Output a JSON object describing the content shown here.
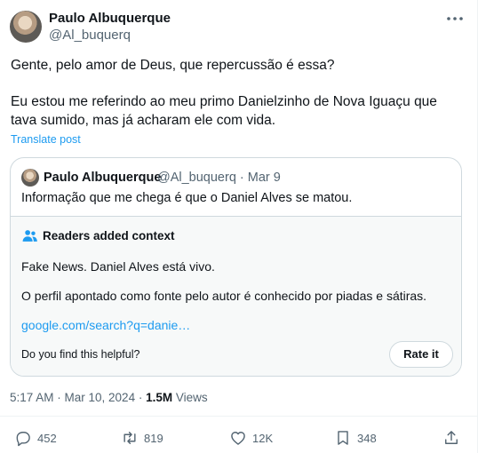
{
  "author": {
    "name": "Paulo Albuquerque",
    "handle": "@Al_buquerq"
  },
  "tweet": {
    "line1": "Gente, pelo amor de Deus, que repercussão é essa?",
    "line2": "Eu estou me referindo ao meu primo Danielzinho de Nova Iguaçu que",
    "line3": "tava sumido, mas já acharam ele com vida.",
    "translate_label": "Translate post"
  },
  "quoted": {
    "name": "Paulo Albuquerque",
    "meta": "@Al_buquerq · Mar 9",
    "text": "Informação que me chega é que o Daniel Alves se matou."
  },
  "note": {
    "title": "Readers added context",
    "p1": "Fake News. Daniel Alves está vivo.",
    "p2": "O perfil apontado como fonte pelo autor é conhecido por piadas e sátiras.",
    "link": "google.com/search?q=danie…",
    "helpful_question": "Do you find this helpful?",
    "rate_label": "Rate it"
  },
  "timestamp": {
    "time": "5:17 AM · Mar 10, 2024 · ",
    "views_count": "1.5M",
    "views_label": " Views"
  },
  "actions": {
    "replies": "452",
    "reposts": "819",
    "likes": "12K",
    "bookmarks": "348"
  },
  "icons": [
    "more-icon",
    "people-icon",
    "reply-icon",
    "repost-icon",
    "like-icon",
    "bookmark-icon",
    "share-icon"
  ],
  "colors": {
    "link": "#1d9bf0",
    "secondary_text": "#536471",
    "primary_text": "#0f1419",
    "border": "#cfd9de",
    "note_background": "#f7f9f9",
    "people_icon": "#1d9bf0"
  }
}
